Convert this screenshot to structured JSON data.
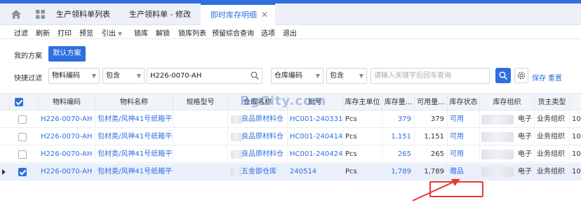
{
  "tabs": {
    "items": [
      {
        "label": "生产领料单列表"
      },
      {
        "label": "生产领料单 - 修改"
      },
      {
        "label": "即时库存明细"
      }
    ]
  },
  "toolbar": {
    "items": [
      {
        "label": "过滤"
      },
      {
        "label": "刷新"
      },
      {
        "label": "打印"
      },
      {
        "label": "预览"
      },
      {
        "label": "引出"
      },
      {
        "label": "锁库"
      },
      {
        "label": "解锁"
      },
      {
        "label": "锁库列表"
      },
      {
        "label": "预留综合查询"
      },
      {
        "label": "选项"
      },
      {
        "label": "退出"
      }
    ]
  },
  "scheme": {
    "mine": "我的方案",
    "default": "默认方案"
  },
  "filter": {
    "label": "快捷过滤",
    "field1": "物料编码",
    "op1": "包含",
    "value1": "H226-0070-AH",
    "field2": "仓库编码",
    "op2": "包含",
    "placeholder2": "请输入关键字后回车查询",
    "save": "保存",
    "reset": "重置"
  },
  "table": {
    "headers": [
      "物料编码",
      "物料名称",
      "规格型号",
      "仓库名称",
      "批号",
      "库存主单位",
      "库存量...",
      "可用量...",
      "库存状态",
      "库存组织",
      "货主类型"
    ],
    "rows": [
      {
        "code": "H226-0070-AH",
        "name": "包材类/风神41号纸箱平卡",
        "warehouse": "良品原材料仓",
        "lot": "HC001-240331",
        "unit": "Pcs",
        "qty": "379",
        "avail": "379",
        "status": "可用",
        "org": "电子",
        "owner_type": "业务组织",
        "extra": "10",
        "checked": false
      },
      {
        "code": "H226-0070-AH",
        "name": "包材类/风神41号纸箱平卡",
        "warehouse": "良品原材料仓",
        "lot": "HC001-240414",
        "unit": "Pcs",
        "qty": "1,151",
        "avail": "1,151",
        "status": "可用",
        "org": "电子",
        "owner_type": "业务组织",
        "extra": "10",
        "checked": false
      },
      {
        "code": "H226-0070-AH",
        "name": "包材类/风神41号纸箱平卡",
        "warehouse": "良品原材料仓",
        "lot": "HC001-240424",
        "unit": "Pcs",
        "qty": "265",
        "avail": "265",
        "status": "可用",
        "org": "电子",
        "owner_type": "业务组织",
        "extra": "10",
        "checked": false
      },
      {
        "code": "H226-0070-AH",
        "name": "包材类/风神41号纸箱平卡",
        "warehouse": "五金部仓库",
        "lot": "240514",
        "unit": "Pcs",
        "qty": "1,789",
        "avail": "1,789",
        "status": "赠品",
        "org": "电子",
        "owner_type": "业务组织",
        "extra": "10",
        "checked": true
      }
    ]
  },
  "watermark": "BgCity.com",
  "colors": {
    "accent": "#2f6fe0",
    "highlight": "#e53935"
  }
}
